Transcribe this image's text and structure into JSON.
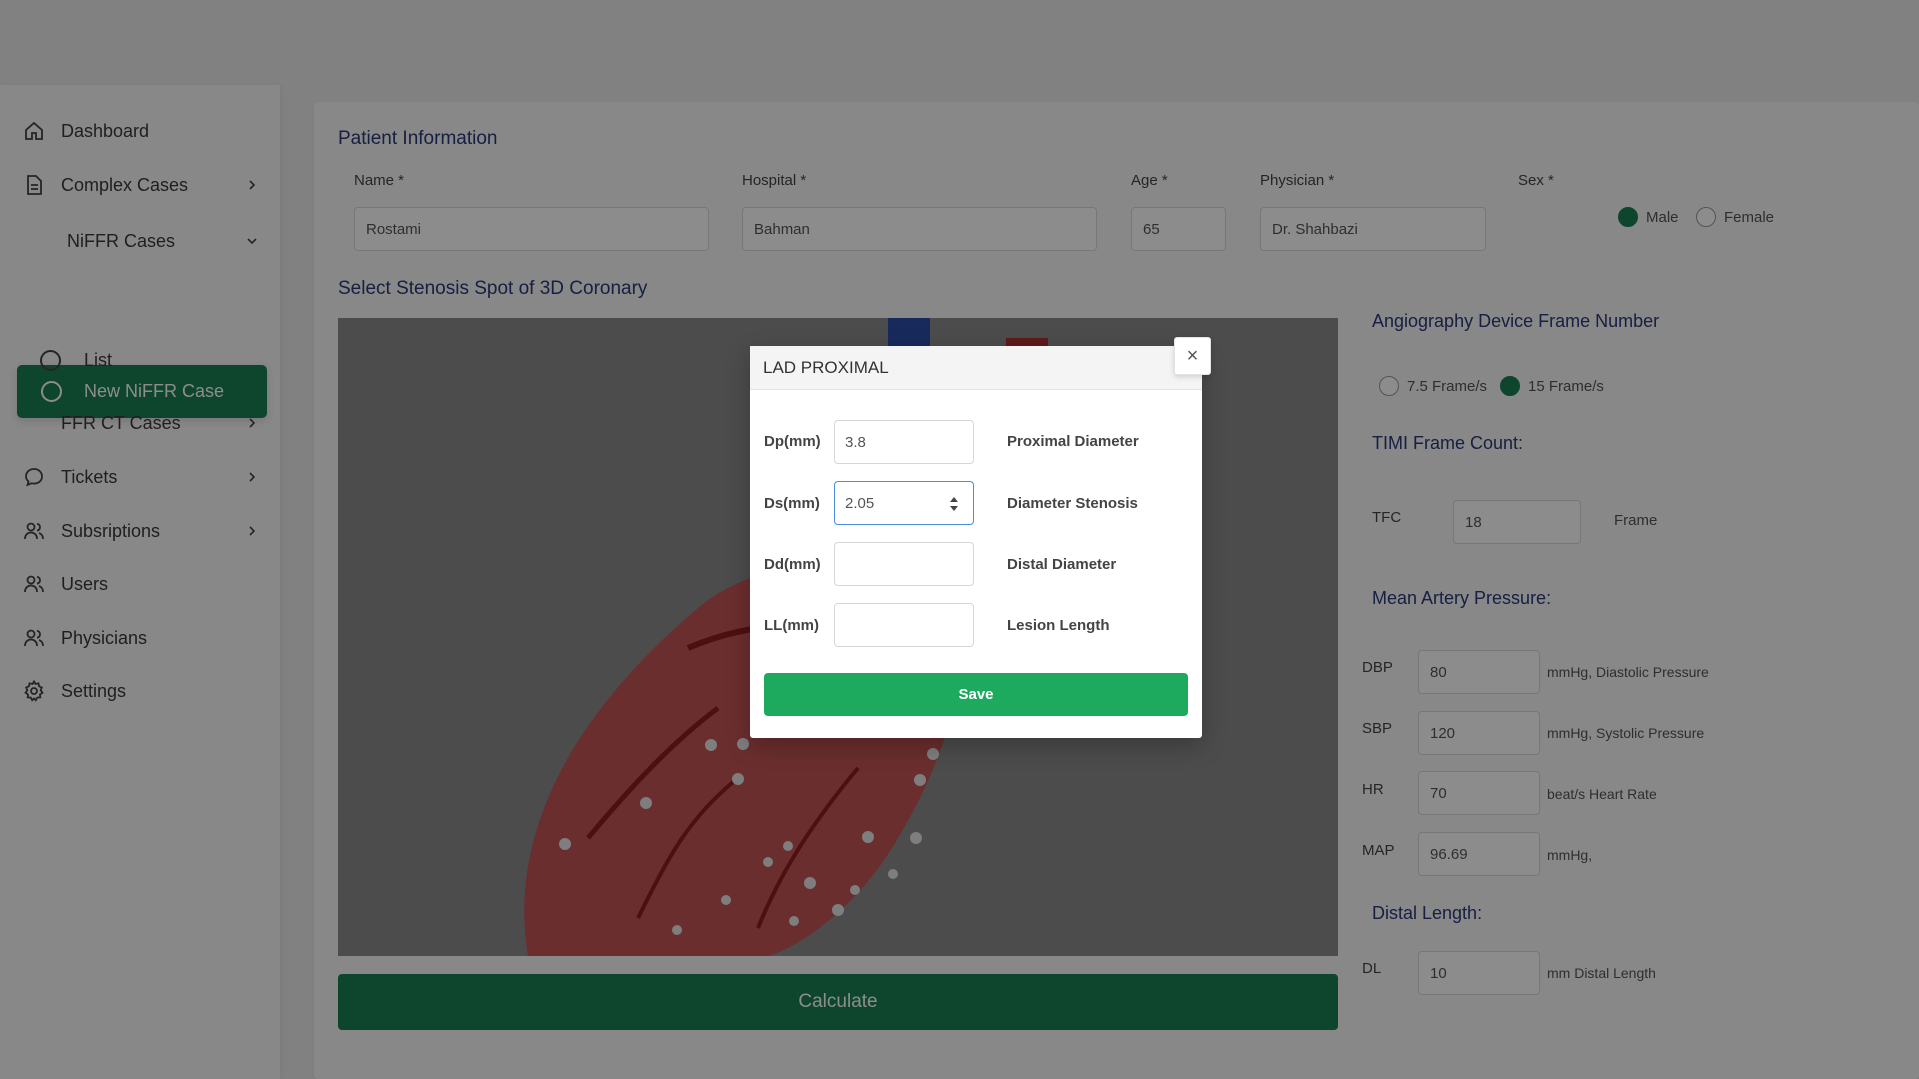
{
  "sidebar": {
    "items": [
      {
        "label": "Dashboard",
        "icon": "home-icon"
      },
      {
        "label": "Complex Cases",
        "icon": "document-icon"
      },
      {
        "label": "NiFFR Cases"
      },
      {
        "label": "New NiFFR Case"
      },
      {
        "label": "List"
      },
      {
        "label": "FFR CT Cases"
      },
      {
        "label": "Tickets",
        "icon": "chat-bubble-icon"
      },
      {
        "label": "Subsriptions",
        "icon": "users-icon"
      },
      {
        "label": "Users",
        "icon": "user-icon"
      },
      {
        "label": "Physicians",
        "icon": "user-icon"
      },
      {
        "label": "Settings",
        "icon": "gear-icon"
      }
    ],
    "active_color": "#1a7f52"
  },
  "patient": {
    "title": "Patient Information",
    "name_label": "Name *",
    "name_value": "Rostami",
    "hospital_label": "Hospital *",
    "hospital_value": "Bahman",
    "age_label": "Age *",
    "age_value": "65",
    "physician_label": "Physician *",
    "physician_value": "Dr. Shahbazi",
    "sex_label": "Sex *",
    "sex_options": [
      "Male",
      "Female"
    ],
    "sex_selected": "Male"
  },
  "stenosis": {
    "title": "Select Stenosis Spot of 3D Coronary"
  },
  "frame": {
    "title": "Angiography Device Frame Number",
    "options": [
      "7.5 Frame/s",
      "15 Frame/s"
    ],
    "selected": "15 Frame/s"
  },
  "timi": {
    "title": "TIMI Frame Count:",
    "tfc_label": "TFC",
    "tfc_value": "18",
    "unit": "Frame"
  },
  "pressure": {
    "title": "Mean Artery Pressure:",
    "rows": [
      {
        "label": "DBP",
        "value": "80",
        "unit": "mmHg, Diastolic Pressure"
      },
      {
        "label": "SBP",
        "value": "120",
        "unit": "mmHg, Systolic Pressure"
      },
      {
        "label": "HR",
        "value": "70",
        "unit": "beat/s Heart Rate"
      },
      {
        "label": "MAP",
        "value": "96.69",
        "unit": "mmHg,"
      }
    ]
  },
  "distal": {
    "title": "Distal Length:",
    "label": "DL",
    "value": "10",
    "unit": "mm Distal Length"
  },
  "calculate_label": "Calculate",
  "modal": {
    "title": "LAD PROXIMAL",
    "rows": [
      {
        "label": "Dp(mm)",
        "value": "3.8",
        "desc": "Proximal Diameter"
      },
      {
        "label": "Ds(mm)",
        "value": "2.05",
        "desc": "Diameter Stenosis"
      },
      {
        "label": "Dd(mm)",
        "value": "",
        "desc": "Distal Diameter"
      },
      {
        "label": "LL(mm)",
        "value": "",
        "desc": "Lesion Length"
      }
    ],
    "save_label": "Save",
    "close_glyph": "×",
    "save_color": "#1eaa5e"
  }
}
